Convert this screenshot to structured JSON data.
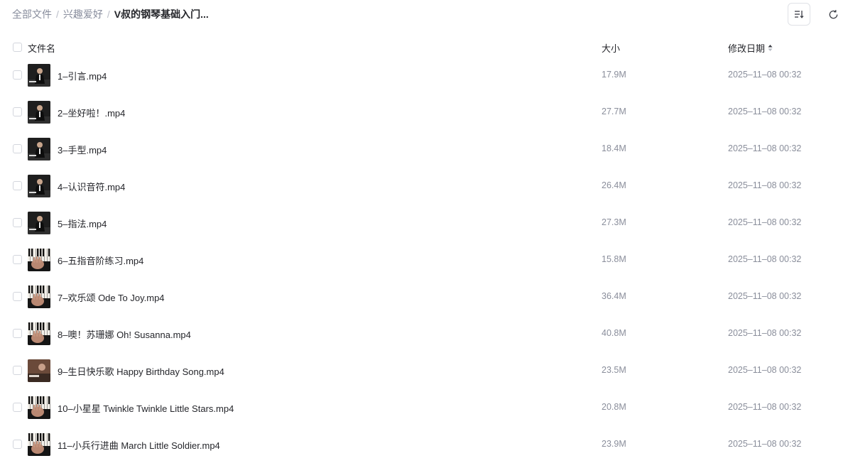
{
  "breadcrumb": {
    "items": [
      "全部文件",
      "兴趣爱好"
    ],
    "separator": "/",
    "current": "V叔的钢琴基础入门..."
  },
  "toolbar": {
    "sort_icon": "sort-list-icon",
    "refresh_icon": "refresh-icon"
  },
  "table": {
    "headers": {
      "name": "文件名",
      "size": "大小",
      "date": "修改日期"
    },
    "rows": [
      {
        "name": "1–引言.mp4",
        "size": "17.9M",
        "date": "2025–11–08 00:32",
        "thumb": "person"
      },
      {
        "name": "2–坐好啦！.mp4",
        "size": "27.7M",
        "date": "2025–11–08 00:32",
        "thumb": "person"
      },
      {
        "name": "3–手型.mp4",
        "size": "18.4M",
        "date": "2025–11–08 00:32",
        "thumb": "person"
      },
      {
        "name": "4–认识音符.mp4",
        "size": "26.4M",
        "date": "2025–11–08 00:32",
        "thumb": "person"
      },
      {
        "name": "5–指法.mp4",
        "size": "27.3M",
        "date": "2025–11–08 00:32",
        "thumb": "person"
      },
      {
        "name": "6–五指音阶练习.mp4",
        "size": "15.8M",
        "date": "2025–11–08 00:32",
        "thumb": "piano"
      },
      {
        "name": "7–欢乐颂 Ode To Joy.mp4",
        "size": "36.4M",
        "date": "2025–11–08 00:32",
        "thumb": "piano"
      },
      {
        "name": "8–噢！苏珊娜 Oh! Susanna.mp4",
        "size": "40.8M",
        "date": "2025–11–08 00:32",
        "thumb": "piano"
      },
      {
        "name": "9–生日快乐歌 Happy Birthday Song.mp4",
        "size": "23.5M",
        "date": "2025–11–08 00:32",
        "thumb": "warm"
      },
      {
        "name": "10–小星星 Twinkle Twinkle Little Stars.mp4",
        "size": "20.8M",
        "date": "2025–11–08 00:32",
        "thumb": "piano"
      },
      {
        "name": "11–小兵行进曲 March Little Soldier.mp4",
        "size": "23.9M",
        "date": "2025–11–08 00:32",
        "thumb": "piano"
      }
    ]
  },
  "colors": {
    "text_primary": "#25262b",
    "text_secondary": "#878c9c",
    "border": "#dfe1e6"
  }
}
